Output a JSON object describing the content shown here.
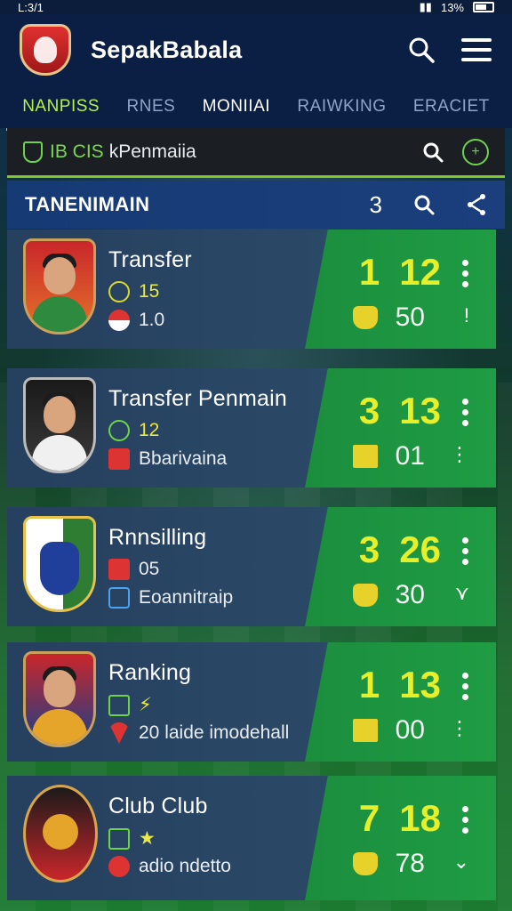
{
  "status_bar": {
    "time": "L:3/1",
    "battery_text": "13%"
  },
  "app": {
    "title": "SepakBabala"
  },
  "tabs": [
    {
      "label": "NANPISS",
      "active": true
    },
    {
      "label": "RNES",
      "active": false
    },
    {
      "label": "MONIIAI",
      "active": false
    },
    {
      "label": "RAIWKING",
      "active": false
    },
    {
      "label": "ERACIET",
      "active": false
    }
  ],
  "search_strip": {
    "code": "IB CIS",
    "text": "kPenmaiia"
  },
  "section": {
    "title": "TANENIMAIN",
    "count": "3"
  },
  "colors": {
    "accent_green": "#1f9c44",
    "score_yellow": "#e6ef2a",
    "header_blue": "#0b1f45"
  },
  "cards": [
    {
      "name": "Transfer",
      "stat1": "15",
      "stat2": "1.0",
      "score_a": "1",
      "score_b": "12",
      "sub": "50",
      "trail": "!"
    },
    {
      "name": "Transfer Penmain",
      "stat1": "12",
      "stat2": "Bbarivaina",
      "score_a": "3",
      "score_b": "13",
      "sub": "01",
      "trail": "⋮"
    },
    {
      "name": "Rnnsilling",
      "stat1": "05",
      "stat2": "Eoannitraip",
      "score_a": "3",
      "score_b": "26",
      "sub": "30",
      "trail": "⋎"
    },
    {
      "name": "Ranking",
      "stat1": "⚡",
      "stat2": "20 laide imodehall",
      "score_a": "1",
      "score_b": "13",
      "sub": "00",
      "trail": "⋮"
    },
    {
      "name": "Club Club",
      "stat1": "★",
      "stat2": "adio ndetto",
      "score_a": "7",
      "score_b": "18",
      "sub": "78",
      "trail": "⌄"
    }
  ]
}
